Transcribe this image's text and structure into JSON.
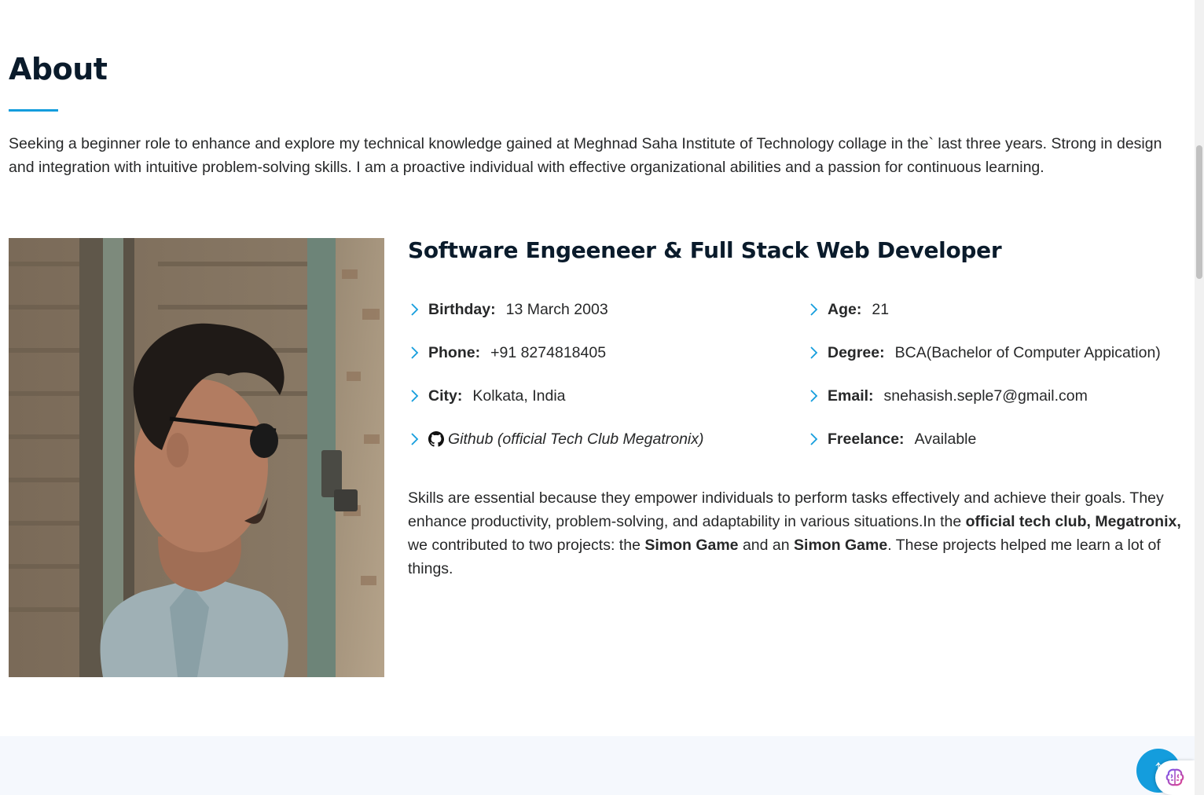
{
  "colors": {
    "accent": "#149ddd",
    "heading": "#0a1b2b",
    "text": "#272829",
    "alt_section_bg": "#f5f8fd"
  },
  "about": {
    "title": "About",
    "intro": "Seeking a beginner role to enhance and explore my technical knowledge gained at Meghnad Saha Institute of Technology collage in the` last three years. Strong in design and integration with intuitive problem-solving skills. I am a proactive individual with effective organizational abilities and a passion for continuous learning.",
    "role": "Software Engeeneer & Full Stack Web Developer",
    "info": {
      "birthday": {
        "key": "Birthday:",
        "value": "13 March 2003"
      },
      "phone": {
        "key": "Phone:",
        "value": "+91 8274818405"
      },
      "city": {
        "key": "City:",
        "value": "Kolkata, India"
      },
      "github": {
        "label": "Github (official Tech Club Megatronix)",
        "icon": "github-icon"
      },
      "age": {
        "key": "Age:",
        "value": "21"
      },
      "degree": {
        "key": "Degree:",
        "value": "BCA(Bachelor of Computer Appication)"
      },
      "email": {
        "key": "Email:",
        "value": "snehasish.seple7@gmail.com"
      },
      "freelance": {
        "key": "Freelance:",
        "value": "Available"
      }
    },
    "skills": {
      "part1": "Skills are essential because they empower individuals to perform tasks effectively and achieve their goals. They enhance productivity, problem-solving, and adaptability in various situations.In the ",
      "bold1": "official tech club, Megatronix,",
      "part2": " we contributed to two projects: the ",
      "bold2": "Simon Game",
      "part3": " and an ",
      "bold3": "Simon Game",
      "part4": ". These projects helped me learn a lot of things."
    }
  },
  "back_to_top": {
    "icon": "arrow-up-icon"
  },
  "extension_widget": {
    "icon": "brain-icon"
  }
}
